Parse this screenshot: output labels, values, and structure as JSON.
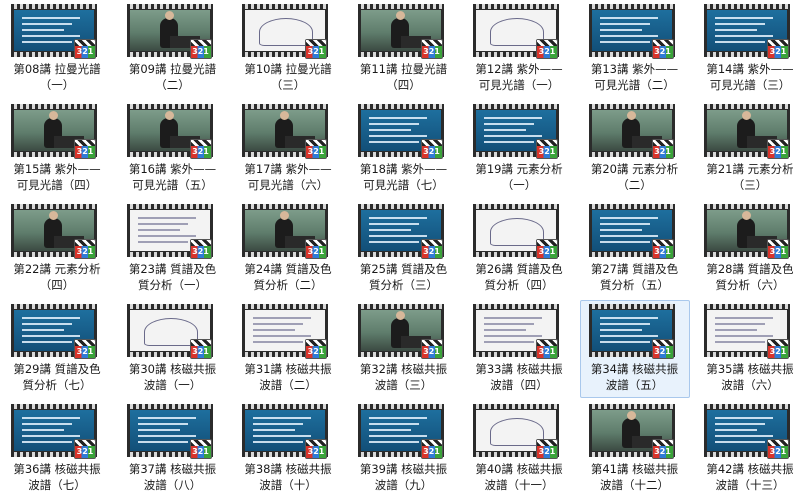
{
  "badge_text": "321",
  "items": [
    {
      "line1": "第08講 拉曼光譜",
      "line2": "（一）",
      "thumb": "slide"
    },
    {
      "line1": "第09講 拉曼光譜",
      "line2": "（二）",
      "thumb": "room"
    },
    {
      "line1": "第10講 拉曼光譜",
      "line2": "（三）",
      "thumb": "white"
    },
    {
      "line1": "第11講 拉曼光譜",
      "line2": "（四）",
      "thumb": "room"
    },
    {
      "line1": "第12講 紫外——",
      "line2": "可見光譜（一）",
      "thumb": "white"
    },
    {
      "line1": "第13講 紫外——",
      "line2": "可見光譜（二）",
      "thumb": "slide"
    },
    {
      "line1": "第14講 紫外——",
      "line2": "可見光譜（三）",
      "thumb": "slide"
    },
    {
      "line1": "第15講 紫外——",
      "line2": "可見光譜（四）",
      "thumb": "room"
    },
    {
      "line1": "第16講 紫外——",
      "line2": "可見光譜（五）",
      "thumb": "room"
    },
    {
      "line1": "第17講 紫外——",
      "line2": "可見光譜（六）",
      "thumb": "room"
    },
    {
      "line1": "第18講 紫外——",
      "line2": "可見光譜（七）",
      "thumb": "slide"
    },
    {
      "line1": "第19講 元素分析",
      "line2": "（一）",
      "thumb": "slide"
    },
    {
      "line1": "第20講 元素分析",
      "line2": "（二）",
      "thumb": "room"
    },
    {
      "line1": "第21講 元素分析",
      "line2": "（三）",
      "thumb": "room"
    },
    {
      "line1": "第22講 元素分析",
      "line2": "（四）",
      "thumb": "room"
    },
    {
      "line1": "第23講 質譜及色",
      "line2": "質分析（一）",
      "thumb": "white"
    },
    {
      "line1": "第24講 質譜及色",
      "line2": "質分析（二）",
      "thumb": "room"
    },
    {
      "line1": "第25講 質譜及色",
      "line2": "質分析（三）",
      "thumb": "slide"
    },
    {
      "line1": "第26講 質譜及色",
      "line2": "質分析（四）",
      "thumb": "white"
    },
    {
      "line1": "第27講 質譜及色",
      "line2": "質分析（五）",
      "thumb": "slide"
    },
    {
      "line1": "第28講 質譜及色",
      "line2": "質分析（六）",
      "thumb": "room"
    },
    {
      "line1": "第29講 質譜及色",
      "line2": "質分析（七）",
      "thumb": "slide"
    },
    {
      "line1": "第30講 核磁共振",
      "line2": "波譜（一）",
      "thumb": "white"
    },
    {
      "line1": "第31講 核磁共振",
      "line2": "波譜（二）",
      "thumb": "white"
    },
    {
      "line1": "第32講 核磁共振",
      "line2": "波譜（三）",
      "thumb": "room"
    },
    {
      "line1": "第33講 核磁共振",
      "line2": "波譜（四）",
      "thumb": "white"
    },
    {
      "line1": "第34講 核磁共振",
      "line2": "波譜（五）",
      "thumb": "slide",
      "selected": true
    },
    {
      "line1": "第35講 核磁共振",
      "line2": "波譜（六）",
      "thumb": "white"
    },
    {
      "line1": "第36講 核磁共振",
      "line2": "波譜（七）",
      "thumb": "slide"
    },
    {
      "line1": "第37講 核磁共振",
      "line2": "波譜（八）",
      "thumb": "slide"
    },
    {
      "line1": "第38講 核磁共振",
      "line2": "波譜（十）",
      "thumb": "slide"
    },
    {
      "line1": "第39講 核磁共振",
      "line2": "波譜（九）",
      "thumb": "slide"
    },
    {
      "line1": "第40講 核磁共振",
      "line2": "波譜（十一）",
      "thumb": "white"
    },
    {
      "line1": "第41講 核磁共振",
      "line2": "波譜（十二）",
      "thumb": "room"
    },
    {
      "line1": "第42講 核磁共振",
      "line2": "波譜（十三）",
      "thumb": "slide"
    }
  ]
}
